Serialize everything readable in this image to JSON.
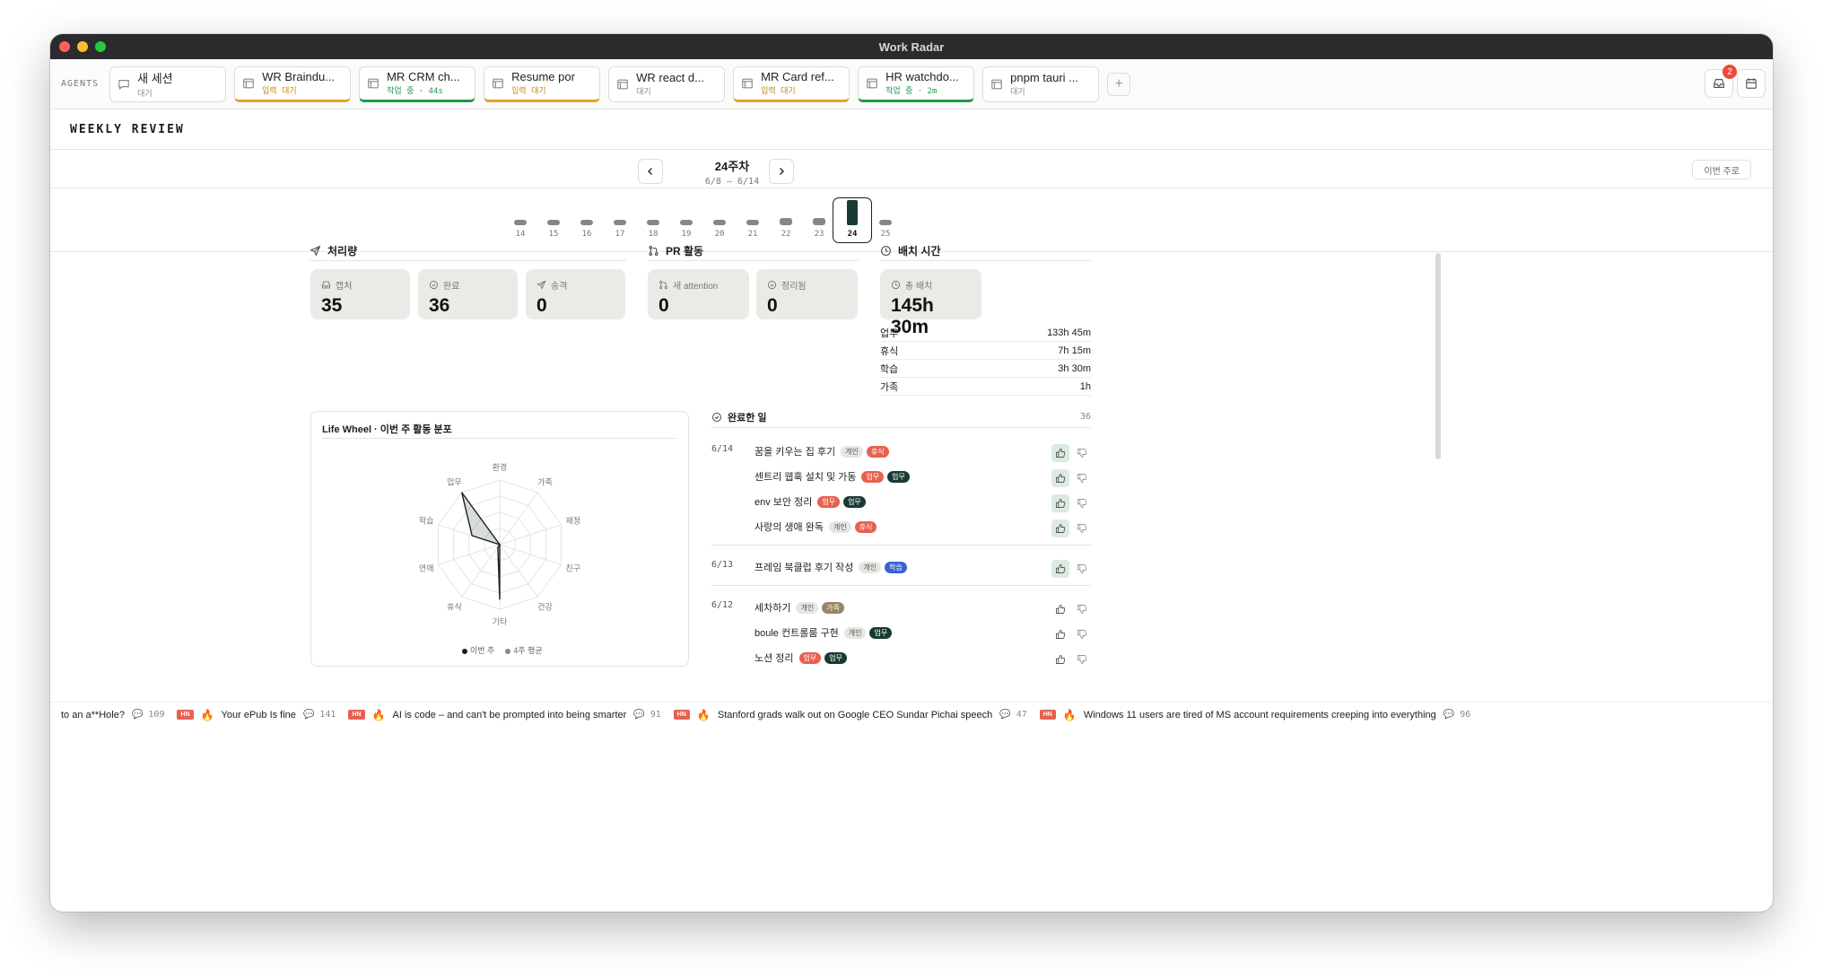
{
  "window": {
    "title": "Work Radar"
  },
  "agents": {
    "label": "AGENTS",
    "tabs": [
      {
        "name": "새 세션",
        "status": "대기",
        "state": "idle",
        "icon": "chat-icon"
      },
      {
        "name": "WR Braindu...",
        "status": "입력 대기",
        "state": "input",
        "icon": "window-icon"
      },
      {
        "name": "MR CRM ch...",
        "status": "작업 중 · 44s",
        "state": "working",
        "icon": "window-icon"
      },
      {
        "name": "Resume por",
        "status": "입력 대기",
        "state": "input",
        "icon": "window-icon"
      },
      {
        "name": "WR react d...",
        "status": "대기",
        "state": "idle",
        "icon": "window-icon"
      },
      {
        "name": "MR Card ref...",
        "status": "입력 대기",
        "state": "input",
        "icon": "window-icon"
      },
      {
        "name": "HR watchdo...",
        "status": "작업 중 · 2m",
        "state": "working",
        "icon": "window-icon"
      },
      {
        "name": "pnpm tauri ...",
        "status": "대기",
        "state": "idle",
        "icon": "window-icon"
      }
    ],
    "add_label": "+",
    "inbox_badge": "2"
  },
  "section": {
    "title": "WEEKLY REVIEW"
  },
  "week_nav": {
    "label": "24주차",
    "range": "6/8 – 6/14",
    "this_week": "이번 주로"
  },
  "weeks": [
    {
      "label": "14",
      "level": 0.1
    },
    {
      "label": "15",
      "level": 0.1
    },
    {
      "label": "16",
      "level": 0.1
    },
    {
      "label": "17",
      "level": 0.1
    },
    {
      "label": "18",
      "level": 0.1
    },
    {
      "label": "19",
      "level": 0.1
    },
    {
      "label": "20",
      "level": 0.1
    },
    {
      "label": "21",
      "level": 0.1
    },
    {
      "label": "22",
      "level": 0.3
    },
    {
      "label": "23",
      "level": 0.3
    },
    {
      "label": "24",
      "level": 1.0,
      "current": true
    },
    {
      "label": "25",
      "level": 0.1
    }
  ],
  "throughput": {
    "title": "처리량",
    "stats": [
      {
        "label": "캡처",
        "value": "35",
        "icon": "inbox-icon"
      },
      {
        "label": "완료",
        "value": "36",
        "icon": "check-circle-icon"
      },
      {
        "label": "송격",
        "value": "0",
        "icon": "send-icon"
      }
    ]
  },
  "pr": {
    "title": "PR 활동",
    "stats": [
      {
        "label": "새 attention",
        "value": "0",
        "icon": "pull-request-icon"
      },
      {
        "label": "정리됨",
        "value": "0",
        "icon": "check-circle-icon"
      }
    ]
  },
  "placement": {
    "title": "배치 시간",
    "total_label": "총 배치",
    "total_value": "145h 30m",
    "rows": [
      {
        "label": "업무",
        "value": "133h 45m"
      },
      {
        "label": "휴식",
        "value": "7h 15m"
      },
      {
        "label": "학습",
        "value": "3h 30m"
      },
      {
        "label": "가족",
        "value": "1h"
      }
    ]
  },
  "life_wheel": {
    "title": "Life Wheel · 이번 주 활동 분포",
    "axes": [
      "환경",
      "가족",
      "재정",
      "친구",
      "건강",
      "기타",
      "휴식",
      "연애",
      "학습",
      "업무"
    ],
    "this_week": [
      0,
      0,
      0,
      0,
      0,
      0.85,
      0.05,
      0,
      0.45,
      1.0
    ],
    "legend": [
      "이번 주",
      "4주 평균"
    ],
    "colors": {
      "this_week": "#1d1d1f",
      "avg": "#888888"
    }
  },
  "done": {
    "title": "완료한 일",
    "count": "36",
    "groups": [
      {
        "date": "6/14",
        "items": [
          {
            "text": "꿈을 키우는 집 후기",
            "tags": [
              {
                "t": "개인",
                "c": "personal"
              },
              {
                "t": "휴식",
                "c": "rest"
              }
            ],
            "liked": true
          },
          {
            "text": "센트리 웹훅 설치 및 가동",
            "tags": [
              {
                "t": "업무",
                "c": "workred"
              },
              {
                "t": "업무",
                "c": "work"
              }
            ],
            "liked": true
          },
          {
            "text": "env 보안 정리",
            "tags": [
              {
                "t": "업무",
                "c": "workred"
              },
              {
                "t": "업무",
                "c": "work"
              }
            ],
            "liked": true
          },
          {
            "text": "사랑의 생애 완독",
            "tags": [
              {
                "t": "개인",
                "c": "personal"
              },
              {
                "t": "휴식",
                "c": "rest"
              }
            ],
            "liked": true
          }
        ]
      },
      {
        "date": "6/13",
        "items": [
          {
            "text": "프레임 북클럽 후기 작성",
            "tags": [
              {
                "t": "개인",
                "c": "personal"
              },
              {
                "t": "학습",
                "c": "learn"
              }
            ],
            "liked": true
          }
        ]
      },
      {
        "date": "6/12",
        "items": [
          {
            "text": "세차하기",
            "tags": [
              {
                "t": "개인",
                "c": "personal"
              },
              {
                "t": "가족",
                "c": "family"
              }
            ],
            "liked": false
          },
          {
            "text": "boule 컨트롤룸 구현",
            "tags": [
              {
                "t": "개인",
                "c": "personal"
              },
              {
                "t": "업무",
                "c": "work"
              }
            ],
            "liked": false
          },
          {
            "text": "노션 정리",
            "tags": [
              {
                "t": "업무",
                "c": "workred"
              },
              {
                "t": "업무",
                "c": "work"
              }
            ],
            "liked": false
          }
        ]
      }
    ]
  },
  "ticker": [
    {
      "title": "to an a**Hole?",
      "count": "109",
      "badge": "",
      "fire": false
    },
    {
      "title": "Your ePub Is fine",
      "count": "141",
      "badge": "HN",
      "fire": true
    },
    {
      "title": "AI is code – and can't be prompted into being smarter",
      "count": "91",
      "badge": "HN",
      "fire": true
    },
    {
      "title": "Stanford grads walk out on Google CEO Sundar Pichai speech",
      "count": "47",
      "badge": "HN",
      "fire": true
    },
    {
      "title": "Windows 11 users are tired of MS account requirements creeping into everything",
      "count": "96",
      "badge": "HN",
      "fire": true
    }
  ]
}
